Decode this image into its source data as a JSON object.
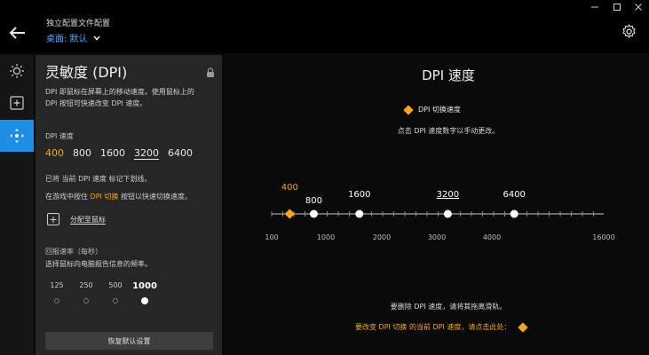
{
  "header": {
    "title": "独立配置文件配置",
    "profile": "桌面: 默认"
  },
  "panel": {
    "title": "灵敏度 (DPI)",
    "description_line1": "DPI 即鼠标在屏幕上的移动速度。使用鼠标上的",
    "description_line2": "DPI 按钮可快速改变 DPI 速度。",
    "speeds_label": "DPI 速度",
    "speeds": [
      "400",
      "800",
      "1600",
      "3200",
      "6400"
    ],
    "note_default": "已将 当前 DPI 速度 标记下划线。",
    "note_switch_prefix": "在游戏中按住 ",
    "note_switch_highlight": "DPI 切换",
    "note_switch_suffix": " 按钮以快速切换速度。",
    "assign_label": "分配至鼠标",
    "report_rate_label": "回报速率（每秒）",
    "report_rate_desc": "选择鼠标向电脑报告信息的频率。",
    "report_rates": [
      "125",
      "250",
      "500",
      "1000"
    ],
    "report_rate_selected": "1000",
    "reset_label": "恢复默认设置"
  },
  "main": {
    "title": "DPI 速度",
    "legend_label": "DPI 切换速度",
    "hint_edit": "点击 DPI 速度数字以手动更改。",
    "hint_delete": "要删除 DPI 速度，请将其拖离滑轨。",
    "hint_switch": "要改变 DPI 切换 的当前 DPI 速度，请点击此处："
  },
  "chart_data": {
    "type": "scatter",
    "axis_ticks": [
      "100",
      "1000",
      "2000",
      "3000",
      "4000",
      "16000"
    ],
    "points": [
      {
        "label": "400",
        "value": 400,
        "marker": "diamond",
        "color": "#f3a81c"
      },
      {
        "label": "800",
        "value": 800,
        "marker": "dot",
        "color": "#ffffff"
      },
      {
        "label": "1600",
        "value": 1600,
        "marker": "dot",
        "color": "#ffffff"
      },
      {
        "label": "3200",
        "value": 3200,
        "marker": "dot",
        "color": "#ffffff",
        "underlined": true
      },
      {
        "label": "6400",
        "value": 6400,
        "marker": "dot",
        "color": "#ffffff"
      }
    ]
  },
  "colors": {
    "accent": "#1f8fe6",
    "highlight": "#f3a81c",
    "link": "#4aa9ff"
  }
}
